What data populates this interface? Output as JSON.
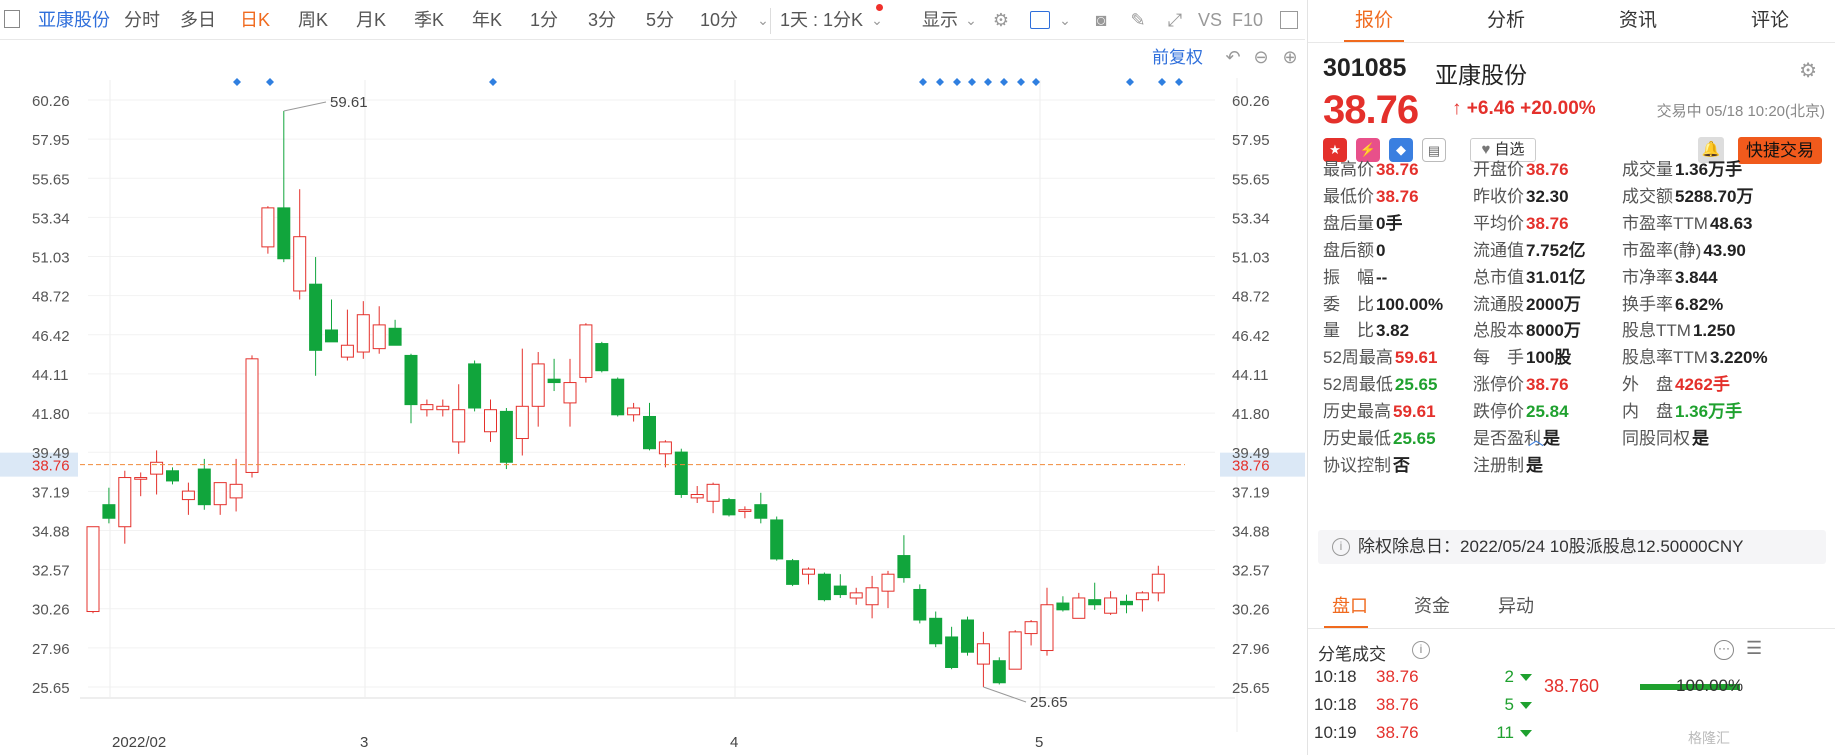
{
  "toolbar": {
    "stock_name": "亚康股份",
    "periods": [
      "分时",
      "多日",
      "日K",
      "周K",
      "月K",
      "季K",
      "年K",
      "1分",
      "3分",
      "5分",
      "10分"
    ],
    "active_period": "日K",
    "combo": "1天 : 1分K",
    "display": "显示",
    "vs": "VS",
    "f10": "F10"
  },
  "chart_toolbar": {
    "adjust": "前复权"
  },
  "chart": {
    "y_ticks": [
      "60.26",
      "57.95",
      "55.65",
      "53.34",
      "51.03",
      "48.72",
      "46.42",
      "44.11",
      "41.80",
      "39.49",
      "37.19",
      "34.88",
      "32.57",
      "30.26",
      "27.96",
      "25.65"
    ],
    "x_labels": [
      "2022/02",
      "3",
      "4",
      "5"
    ],
    "current_price": "38.76",
    "high_label": "59.61",
    "low_label": "25.65",
    "colors": {
      "up": "#e4302b",
      "down": "#11a53c",
      "price_line": "#f08a3a"
    }
  },
  "chart_data": {
    "type": "candlestick",
    "ylim": [
      24.0,
      62.0
    ],
    "candles": [
      {
        "o": 30.1,
        "h": 35.1,
        "l": 30.0,
        "c": 35.1
      },
      {
        "o": 36.4,
        "h": 37.4,
        "l": 35.3,
        "c": 35.6
      },
      {
        "o": 35.1,
        "h": 38.4,
        "l": 34.1,
        "c": 38.0
      },
      {
        "o": 37.9,
        "h": 38.3,
        "l": 36.9,
        "c": 38.0
      },
      {
        "o": 38.2,
        "h": 39.6,
        "l": 37.0,
        "c": 38.9
      },
      {
        "o": 38.4,
        "h": 38.6,
        "l": 37.6,
        "c": 37.8
      },
      {
        "o": 36.7,
        "h": 37.7,
        "l": 35.8,
        "c": 37.2
      },
      {
        "o": 38.5,
        "h": 39.1,
        "l": 36.1,
        "c": 36.4
      },
      {
        "o": 36.4,
        "h": 37.7,
        "l": 35.8,
        "c": 37.7
      },
      {
        "o": 36.8,
        "h": 39.1,
        "l": 36.0,
        "c": 37.6
      },
      {
        "o": 38.3,
        "h": 45.2,
        "l": 38.0,
        "c": 45.0
      },
      {
        "o": 51.6,
        "h": 54.0,
        "l": 51.2,
        "c": 53.9
      },
      {
        "o": 53.9,
        "h": 59.61,
        "l": 50.7,
        "c": 50.9
      },
      {
        "o": 49.0,
        "h": 55.0,
        "l": 48.5,
        "c": 52.2
      },
      {
        "o": 49.4,
        "h": 51.0,
        "l": 44.0,
        "c": 45.5
      },
      {
        "o": 46.7,
        "h": 48.5,
        "l": 46.0,
        "c": 46.0
      },
      {
        "o": 45.1,
        "h": 47.9,
        "l": 44.9,
        "c": 45.8
      },
      {
        "o": 45.4,
        "h": 48.4,
        "l": 45.0,
        "c": 47.6
      },
      {
        "o": 45.6,
        "h": 48.1,
        "l": 45.3,
        "c": 47.0
      },
      {
        "o": 46.8,
        "h": 47.3,
        "l": 45.8,
        "c": 45.8
      },
      {
        "o": 45.2,
        "h": 45.3,
        "l": 41.2,
        "c": 42.3
      },
      {
        "o": 42.0,
        "h": 42.6,
        "l": 41.6,
        "c": 42.3
      },
      {
        "o": 42.0,
        "h": 42.6,
        "l": 41.6,
        "c": 42.2
      },
      {
        "o": 40.1,
        "h": 43.5,
        "l": 39.4,
        "c": 42.0
      },
      {
        "o": 44.7,
        "h": 44.9,
        "l": 41.9,
        "c": 42.1
      },
      {
        "o": 40.7,
        "h": 42.6,
        "l": 40.1,
        "c": 42.0
      },
      {
        "o": 41.9,
        "h": 42.1,
        "l": 38.5,
        "c": 38.9
      },
      {
        "o": 40.3,
        "h": 45.6,
        "l": 39.3,
        "c": 42.2
      },
      {
        "o": 42.2,
        "h": 45.4,
        "l": 41.0,
        "c": 44.7
      },
      {
        "o": 43.8,
        "h": 45.0,
        "l": 43.1,
        "c": 43.6
      },
      {
        "o": 42.4,
        "h": 45.0,
        "l": 41.0,
        "c": 43.6
      },
      {
        "o": 43.9,
        "h": 47.1,
        "l": 43.6,
        "c": 47.0
      },
      {
        "o": 45.9,
        "h": 46.0,
        "l": 44.2,
        "c": 44.3
      },
      {
        "o": 43.8,
        "h": 43.9,
        "l": 41.6,
        "c": 41.7
      },
      {
        "o": 41.7,
        "h": 42.4,
        "l": 41.3,
        "c": 42.1
      },
      {
        "o": 41.6,
        "h": 42.4,
        "l": 39.6,
        "c": 39.7
      },
      {
        "o": 39.4,
        "h": 40.2,
        "l": 38.6,
        "c": 40.1
      },
      {
        "o": 39.5,
        "h": 39.7,
        "l": 36.8,
        "c": 37.0
      },
      {
        "o": 36.8,
        "h": 37.5,
        "l": 36.5,
        "c": 37.0
      },
      {
        "o": 36.6,
        "h": 37.7,
        "l": 35.9,
        "c": 37.6
      },
      {
        "o": 36.7,
        "h": 36.8,
        "l": 35.7,
        "c": 35.8
      },
      {
        "o": 36.0,
        "h": 36.3,
        "l": 35.6,
        "c": 36.1
      },
      {
        "o": 36.4,
        "h": 37.1,
        "l": 35.3,
        "c": 35.6
      },
      {
        "o": 35.5,
        "h": 35.7,
        "l": 33.1,
        "c": 33.2
      },
      {
        "o": 33.1,
        "h": 33.2,
        "l": 31.6,
        "c": 31.7
      },
      {
        "o": 32.3,
        "h": 32.7,
        "l": 31.7,
        "c": 32.6
      },
      {
        "o": 32.3,
        "h": 32.4,
        "l": 30.7,
        "c": 30.8
      },
      {
        "o": 31.6,
        "h": 32.3,
        "l": 30.9,
        "c": 31.1
      },
      {
        "o": 30.9,
        "h": 31.5,
        "l": 30.5,
        "c": 31.2
      },
      {
        "o": 30.5,
        "h": 32.2,
        "l": 29.7,
        "c": 31.5
      },
      {
        "o": 31.3,
        "h": 32.5,
        "l": 30.3,
        "c": 32.3
      },
      {
        "o": 33.4,
        "h": 34.6,
        "l": 31.8,
        "c": 32.1
      },
      {
        "o": 31.4,
        "h": 31.7,
        "l": 29.4,
        "c": 29.6
      },
      {
        "o": 29.7,
        "h": 30.1,
        "l": 28.0,
        "c": 28.2
      },
      {
        "o": 28.6,
        "h": 29.2,
        "l": 26.7,
        "c": 26.8
      },
      {
        "o": 29.6,
        "h": 29.8,
        "l": 27.5,
        "c": 27.7
      },
      {
        "o": 27.0,
        "h": 28.9,
        "l": 25.65,
        "c": 28.2
      },
      {
        "o": 27.2,
        "h": 27.4,
        "l": 25.8,
        "c": 25.9
      },
      {
        "o": 26.7,
        "h": 29.0,
        "l": 26.7,
        "c": 28.9
      },
      {
        "o": 28.8,
        "h": 29.6,
        "l": 28.1,
        "c": 29.5
      },
      {
        "o": 27.8,
        "h": 31.5,
        "l": 27.5,
        "c": 30.5
      },
      {
        "o": 30.6,
        "h": 31.0,
        "l": 30.1,
        "c": 30.2
      },
      {
        "o": 29.7,
        "h": 31.2,
        "l": 29.7,
        "c": 30.9
      },
      {
        "o": 30.8,
        "h": 31.8,
        "l": 30.2,
        "c": 30.5
      },
      {
        "o": 30.0,
        "h": 31.3,
        "l": 29.9,
        "c": 30.9
      },
      {
        "o": 30.7,
        "h": 31.1,
        "l": 30.0,
        "c": 30.5
      },
      {
        "o": 30.8,
        "h": 31.3,
        "l": 30.1,
        "c": 31.2
      },
      {
        "o": 31.2,
        "h": 32.8,
        "l": 30.7,
        "c": 32.3
      }
    ],
    "event_markers": [
      5,
      7,
      14,
      25,
      26,
      27,
      28,
      29,
      30,
      31,
      32,
      35,
      36,
      37
    ]
  },
  "panel": {
    "tabs": [
      "报价",
      "分析",
      "资讯",
      "评论"
    ],
    "active_tab": "报价",
    "code": "301085",
    "name": "亚康股份",
    "price": "38.76",
    "change": "↑ +6.46  +20.00%",
    "status": "交易中 05/18 10:20(北京)",
    "watch_label": "自选",
    "quick_trade": "快捷交易",
    "stats": [
      [
        {
          "l": "最高价",
          "v": "38.76",
          "c": "red"
        },
        {
          "l": "开盘价",
          "v": "38.76",
          "c": "red"
        },
        {
          "l": "成交量",
          "v": "1.36万手",
          "c": ""
        }
      ],
      [
        {
          "l": "最低价",
          "v": "38.76",
          "c": "red"
        },
        {
          "l": "昨收价",
          "v": "32.30",
          "c": ""
        },
        {
          "l": "成交额",
          "v": "5288.70万",
          "c": ""
        }
      ],
      [
        {
          "l": "盘后量",
          "v": "0手",
          "c": ""
        },
        {
          "l": "平均价",
          "v": "38.76",
          "c": "red"
        },
        {
          "l": "市盈率TTM",
          "v": "48.63",
          "c": ""
        }
      ],
      [
        {
          "l": "盘后额",
          "v": "0",
          "c": ""
        },
        {
          "l": "流通值",
          "v": "7.752亿",
          "c": ""
        },
        {
          "l": "市盈率(静)",
          "v": "43.90",
          "c": ""
        }
      ],
      [
        {
          "l": "振　幅",
          "v": "--",
          "c": ""
        },
        {
          "l": "总市值",
          "v": "31.01亿",
          "c": ""
        },
        {
          "l": "市净率",
          "v": "3.844",
          "c": ""
        }
      ],
      [
        {
          "l": "委　比",
          "v": "100.00%",
          "c": ""
        },
        {
          "l": "流通股",
          "v": "2000万",
          "c": ""
        },
        {
          "l": "换手率",
          "v": "6.82%",
          "c": ""
        }
      ],
      [
        {
          "l": "量　比",
          "v": "3.82",
          "c": ""
        },
        {
          "l": "总股本",
          "v": "8000万",
          "c": ""
        },
        {
          "l": "股息TTM",
          "v": "1.250",
          "c": ""
        }
      ],
      [
        {
          "l": "52周最高",
          "v": "59.61",
          "c": "red"
        },
        {
          "l": "每　手",
          "v": "100股",
          "c": ""
        },
        {
          "l": "股息率TTM",
          "v": "3.220%",
          "c": ""
        }
      ],
      [
        {
          "l": "52周最低",
          "v": "25.65",
          "c": "green"
        },
        {
          "l": "涨停价",
          "v": "38.76",
          "c": "red"
        },
        {
          "l": "外　盘",
          "v": "4262手",
          "c": "red"
        }
      ],
      [
        {
          "l": "历史最高",
          "v": "59.61",
          "c": "red"
        },
        {
          "l": "跌停价",
          "v": "25.84",
          "c": "green"
        },
        {
          "l": "内　盘",
          "v": "1.36万手",
          "c": "green"
        }
      ],
      [
        {
          "l": "历史最低",
          "v": "25.65",
          "c": "green"
        },
        {
          "l": "是否盈利",
          "v": "是",
          "c": ""
        },
        {
          "l": "同股同权",
          "v": "是",
          "c": ""
        }
      ],
      [
        {
          "l": "协议控制",
          "v": "否",
          "c": ""
        },
        {
          "l": "注册制",
          "v": "是",
          "c": ""
        },
        null
      ]
    ],
    "notice": "除权除息日：2022/05/24  10股派股息12.50000CNY",
    "bottom_tabs": [
      "盘口",
      "资金",
      "异动"
    ],
    "active_bottom_tab": "盘口",
    "trades_title": "分笔成交",
    "trades": [
      {
        "time": "10:18",
        "price": "38.76",
        "vol": "2"
      },
      {
        "time": "10:18",
        "price": "38.76",
        "vol": "5"
      },
      {
        "time": "10:19",
        "price": "38.76",
        "vol": "11"
      }
    ],
    "dist_price": "38.760",
    "dist_pct": "100.00%",
    "dist_fraction": 1.0,
    "watermark": "格隆汇"
  }
}
